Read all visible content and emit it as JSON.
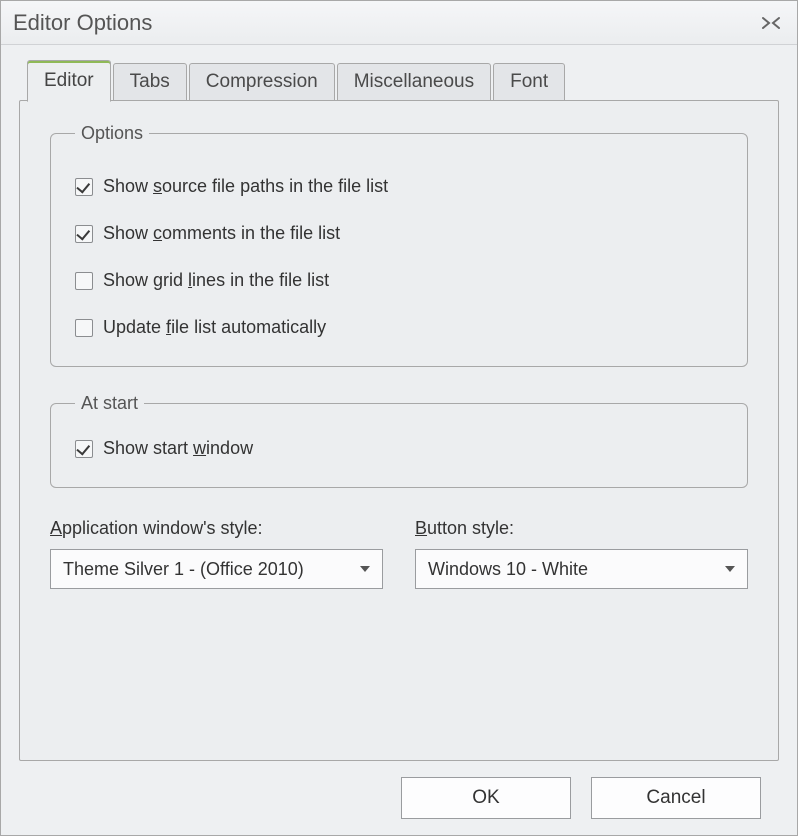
{
  "window": {
    "title": "Editor Options"
  },
  "tabs": [
    {
      "label": "Editor",
      "active": true
    },
    {
      "label": "Tabs",
      "active": false
    },
    {
      "label": "Compression",
      "active": false
    },
    {
      "label": "Miscellaneous",
      "active": false
    },
    {
      "label": "Font",
      "active": false
    }
  ],
  "options_group": {
    "legend": "Options",
    "items": [
      {
        "pre": "Show ",
        "mn": "s",
        "post": "ource file paths in the file list",
        "checked": true
      },
      {
        "pre": "Show ",
        "mn": "c",
        "post": "omments in the file list",
        "checked": true
      },
      {
        "pre": "Show grid ",
        "mn": "l",
        "post": "ines in the file list",
        "checked": false
      },
      {
        "pre": "Update ",
        "mn": "f",
        "post": "ile list automatically",
        "checked": false
      }
    ]
  },
  "atstart_group": {
    "legend": "At start",
    "items": [
      {
        "pre": "Show start ",
        "mn": "w",
        "post": "indow",
        "checked": true
      }
    ]
  },
  "style_section": {
    "app_style_label_pre": "",
    "app_style_label_mn": "A",
    "app_style_label_post": "pplication window's style:",
    "app_style_value": "Theme Silver 1  -  (Office 2010)",
    "btn_style_label_pre": "",
    "btn_style_label_mn": "B",
    "btn_style_label_post": "utton style:",
    "btn_style_value": "Windows 10 - White"
  },
  "buttons": {
    "ok": "OK",
    "cancel": "Cancel"
  }
}
